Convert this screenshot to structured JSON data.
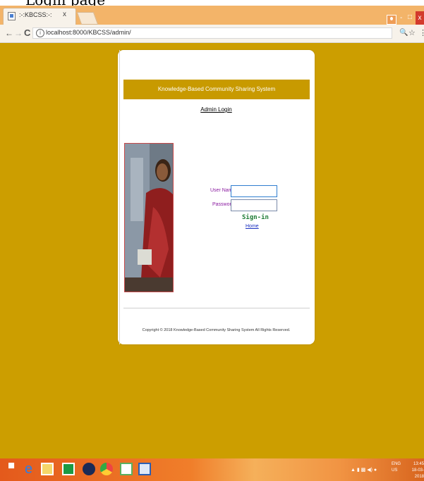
{
  "top_caption": "Login page",
  "browser": {
    "tab_title": ":-:KBCSS:-:",
    "tab_close": "x",
    "url": "localhost:8000/KBCSS/admin/",
    "win_min": "-",
    "win_max": "□",
    "win_close": "x"
  },
  "page": {
    "banner": "Knowledge-Based Community Sharing System",
    "admin_login": "Admin Login",
    "username_label": "User Name:",
    "password_label": "Password :",
    "signin": "Sign-in",
    "home": "Home",
    "copyright": "Copyright © 2018 Knowledge-Based Community Sharing System All Rights Reserved.",
    "username_value": "",
    "password_value": ""
  },
  "taskbar": {
    "language": "ENG",
    "locale": "US",
    "time": "13:45",
    "date": "18-03-2018"
  },
  "colors": {
    "page_bg": "#cc9e00",
    "banner_bg": "#c89a00",
    "label": "#8a1aa0",
    "signin": "#1e7c34"
  }
}
